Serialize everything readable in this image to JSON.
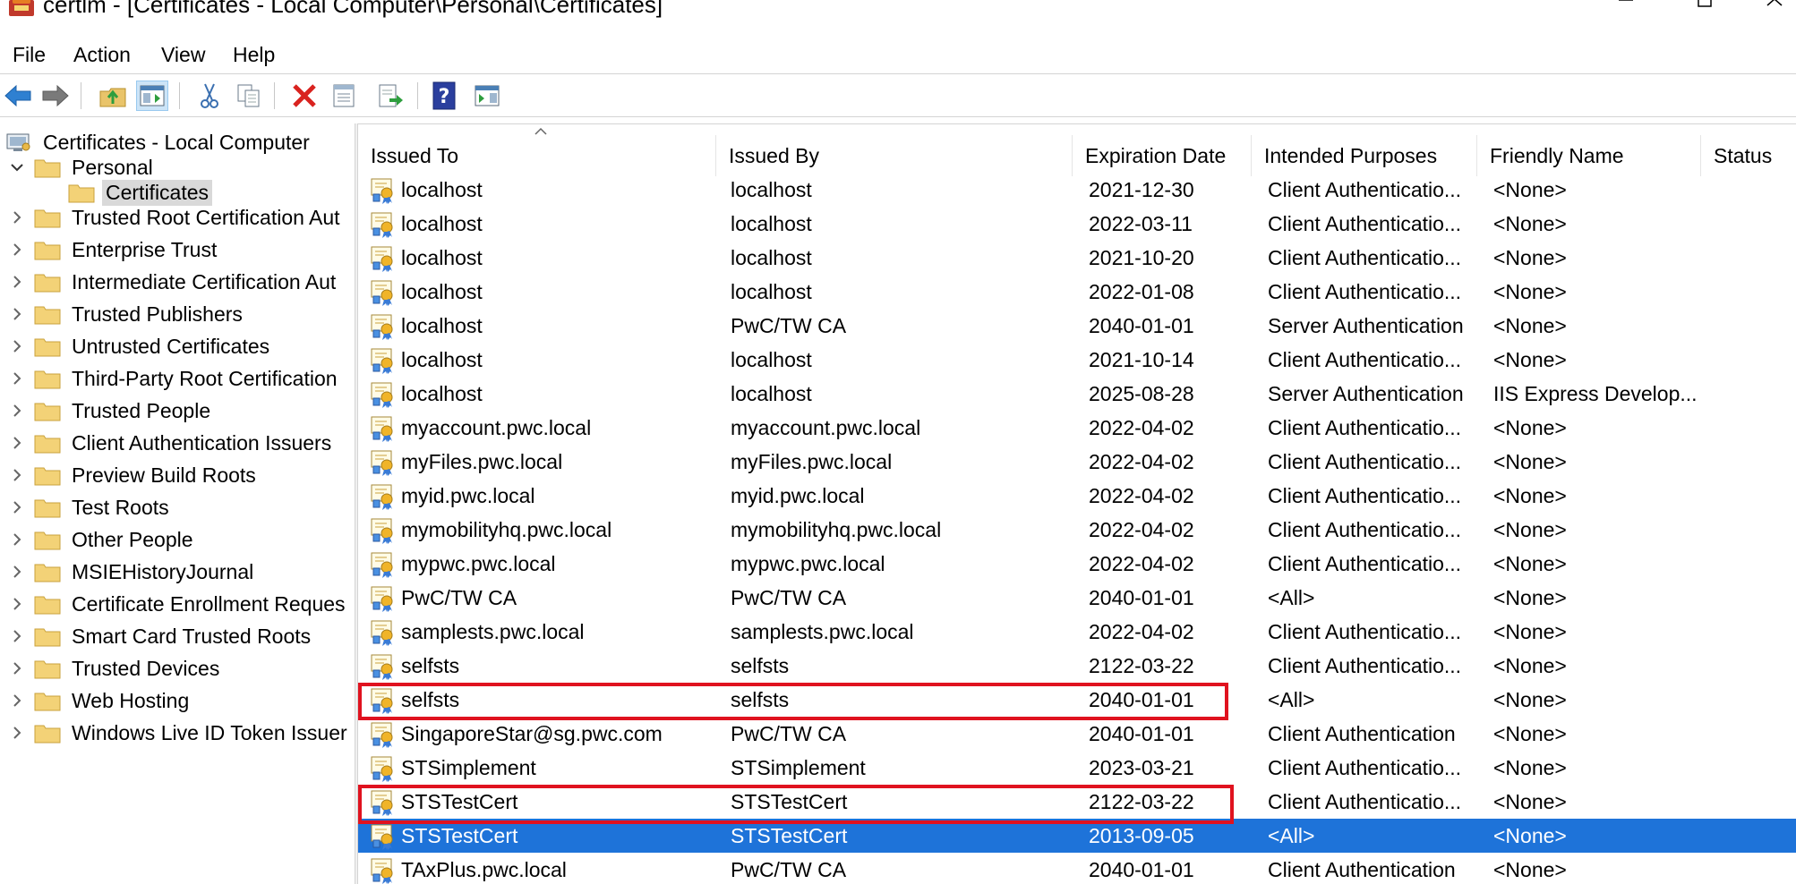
{
  "window": {
    "title": "certlm - [Certificates - Local Computer\\Personal\\Certificates]",
    "icon": "certificate-store-icon"
  },
  "menu": [
    "File",
    "Action",
    "View",
    "Help"
  ],
  "toolbar": {
    "buttons": [
      "back-icon",
      "forward-icon",
      "up-folder-icon",
      "show-hide-tree-icon",
      "cut-icon",
      "copy-icon",
      "delete-icon",
      "properties-icon",
      "export-list-icon",
      "help-icon",
      "action-pane-icon"
    ]
  },
  "tree": {
    "root": "Certificates - Local Computer",
    "personal": "Personal",
    "certificates": "Certificates",
    "items": [
      "Trusted Root Certification Aut",
      "Enterprise Trust",
      "Intermediate Certification Aut",
      "Trusted Publishers",
      "Untrusted Certificates",
      "Third-Party Root Certification",
      "Trusted People",
      "Client Authentication Issuers",
      "Preview Build Roots",
      "Test Roots",
      "Other People",
      "MSIEHistoryJournal",
      "Certificate Enrollment Reques",
      "Smart Card Trusted Roots",
      "Trusted Devices",
      "Web Hosting",
      "Windows Live ID Token Issuer"
    ]
  },
  "columns": [
    "Issued To",
    "Issued By",
    "Expiration Date",
    "Intended Purposes",
    "Friendly Name",
    "Status"
  ],
  "rows": [
    {
      "issued_to": "localhost",
      "issued_by": "localhost",
      "expiration": "2021-12-30",
      "purposes": "Client Authenticatio...",
      "friendly": "<None>",
      "status": ""
    },
    {
      "issued_to": "localhost",
      "issued_by": "localhost",
      "expiration": "2022-03-11",
      "purposes": "Client Authenticatio...",
      "friendly": "<None>",
      "status": ""
    },
    {
      "issued_to": "localhost",
      "issued_by": "localhost",
      "expiration": "2021-10-20",
      "purposes": "Client Authenticatio...",
      "friendly": "<None>",
      "status": ""
    },
    {
      "issued_to": "localhost",
      "issued_by": "localhost",
      "expiration": "2022-01-08",
      "purposes": "Client Authenticatio...",
      "friendly": "<None>",
      "status": ""
    },
    {
      "issued_to": "localhost",
      "issued_by": "PwC/TW CA",
      "expiration": "2040-01-01",
      "purposes": "Server Authentication",
      "friendly": "<None>",
      "status": ""
    },
    {
      "issued_to": "localhost",
      "issued_by": "localhost",
      "expiration": "2021-10-14",
      "purposes": "Client Authenticatio...",
      "friendly": "<None>",
      "status": ""
    },
    {
      "issued_to": "localhost",
      "issued_by": "localhost",
      "expiration": "2025-08-28",
      "purposes": "Server Authentication",
      "friendly": "IIS Express Develop...",
      "status": ""
    },
    {
      "issued_to": "myaccount.pwc.local",
      "issued_by": "myaccount.pwc.local",
      "expiration": "2022-04-02",
      "purposes": "Client Authenticatio...",
      "friendly": "<None>",
      "status": ""
    },
    {
      "issued_to": "myFiles.pwc.local",
      "issued_by": "myFiles.pwc.local",
      "expiration": "2022-04-02",
      "purposes": "Client Authenticatio...",
      "friendly": "<None>",
      "status": ""
    },
    {
      "issued_to": "myid.pwc.local",
      "issued_by": "myid.pwc.local",
      "expiration": "2022-04-02",
      "purposes": "Client Authenticatio...",
      "friendly": "<None>",
      "status": ""
    },
    {
      "issued_to": "mymobilityhq.pwc.local",
      "issued_by": "mymobilityhq.pwc.local",
      "expiration": "2022-04-02",
      "purposes": "Client Authenticatio...",
      "friendly": "<None>",
      "status": ""
    },
    {
      "issued_to": "mypwc.pwc.local",
      "issued_by": "mypwc.pwc.local",
      "expiration": "2022-04-02",
      "purposes": "Client Authenticatio...",
      "friendly": "<None>",
      "status": ""
    },
    {
      "issued_to": "PwC/TW CA",
      "issued_by": "PwC/TW CA",
      "expiration": "2040-01-01",
      "purposes": "<All>",
      "friendly": "<None>",
      "status": ""
    },
    {
      "issued_to": "samplests.pwc.local",
      "issued_by": "samplests.pwc.local",
      "expiration": "2022-04-02",
      "purposes": "Client Authenticatio...",
      "friendly": "<None>",
      "status": ""
    },
    {
      "issued_to": "selfsts",
      "issued_by": "selfsts",
      "expiration": "2122-03-22",
      "purposes": "Client Authenticatio...",
      "friendly": "<None>",
      "status": ""
    },
    {
      "issued_to": "selfsts",
      "issued_by": "selfsts",
      "expiration": "2040-01-01",
      "purposes": "<All>",
      "friendly": "<None>",
      "status": ""
    },
    {
      "issued_to": "SingaporeStar@sg.pwc.com",
      "issued_by": "PwC/TW CA",
      "expiration": "2040-01-01",
      "purposes": "Client Authentication",
      "friendly": "<None>",
      "status": ""
    },
    {
      "issued_to": "STSimplement",
      "issued_by": "STSimplement",
      "expiration": "2023-03-21",
      "purposes": "Client Authenticatio...",
      "friendly": "<None>",
      "status": ""
    },
    {
      "issued_to": "STSTestCert",
      "issued_by": "STSTestCert",
      "expiration": "2122-03-22",
      "purposes": "Client Authenticatio...",
      "friendly": "<None>",
      "status": ""
    },
    {
      "issued_to": "STSTestCert",
      "issued_by": "STSTestCert",
      "expiration": "2013-09-05",
      "purposes": "<All>",
      "friendly": "<None>",
      "status": ""
    },
    {
      "issued_to": "TAxPlus.pwc.local",
      "issued_by": "PwC/TW CA",
      "expiration": "2040-01-01",
      "purposes": "Client Authentication",
      "friendly": "<None>",
      "status": ""
    }
  ],
  "selected_row_index": 19,
  "highlighted_row_indices": [
    15,
    18
  ],
  "colors": {
    "selection": "#1e73d9",
    "highlight_box": "#e0121f",
    "tree_selected": "#d9d9d9"
  }
}
